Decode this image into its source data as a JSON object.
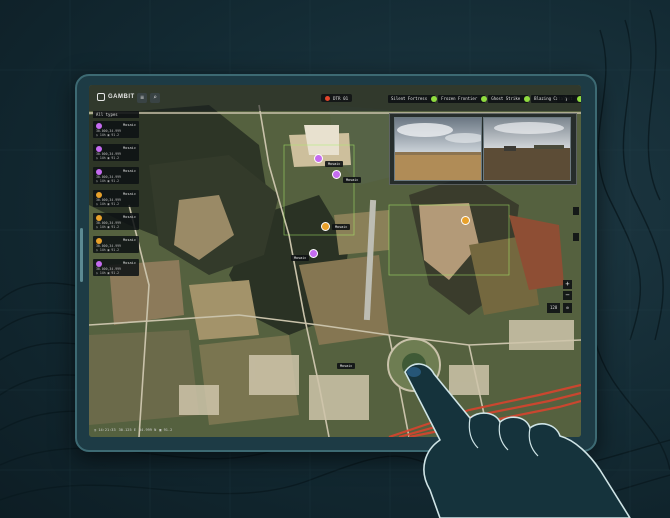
{
  "app": {
    "logo_text": "GAMBIT"
  },
  "header": {
    "status_text": "DTR 01",
    "rec_color": "#e2452b"
  },
  "cameras": {
    "tabs": [
      {
        "label": "Silent Fortress"
      },
      {
        "label": "Frozen Frontier"
      },
      {
        "label": "Ghost Strike"
      },
      {
        "label": "Blazing Catalyst"
      }
    ],
    "status_color": "#8fdc3f"
  },
  "sidebar": {
    "filter_label": "All types",
    "cards": [
      {
        "name": "Mosaic",
        "line1": "30.000,34.999",
        "line2": "◷ 14h  ▣ 91.2"
      },
      {
        "name": "Mosaic",
        "line1": "30.000,34.999",
        "line2": "◷ 14h  ▣ 91.2"
      },
      {
        "name": "Mosaic",
        "line1": "30.000,34.999",
        "line2": "◷ 14h  ▣ 91.2"
      },
      {
        "name": "Mosaic",
        "line1": "30.000,34.999",
        "line2": "◷ 14h  ▣ 91.2"
      },
      {
        "name": "Mosaic",
        "line1": "30.000,34.999",
        "line2": "◷ 14h  ▣ 91.2"
      },
      {
        "name": "Mosaic",
        "line1": "30.000,34.999",
        "line2": "◷ 14h  ▣ 91.2"
      },
      {
        "name": "Mosaic",
        "line1": "30.000,34.999",
        "line2": "◷ 14h  ▣ 91.2"
      }
    ],
    "icon_color_purple": "#c56bf0",
    "icon_color_amber": "#e8a12b"
  },
  "map": {
    "markers": [
      {
        "label": "Mosaic"
      },
      {
        "label": "Mosaic"
      },
      {
        "label": "Mosaic"
      },
      {
        "label": "Mosaic"
      },
      {
        "label": "Mosaic"
      }
    ],
    "zoom_in": "+",
    "zoom_out": "−",
    "layer_button": "128",
    "bottom_info": [
      "◷ 14:21:33",
      "30.125 E",
      "34.999 N",
      "▣ 91.2"
    ]
  },
  "colors": {
    "accent": "#8fdc3f",
    "road_highlight": "#d8442e"
  }
}
